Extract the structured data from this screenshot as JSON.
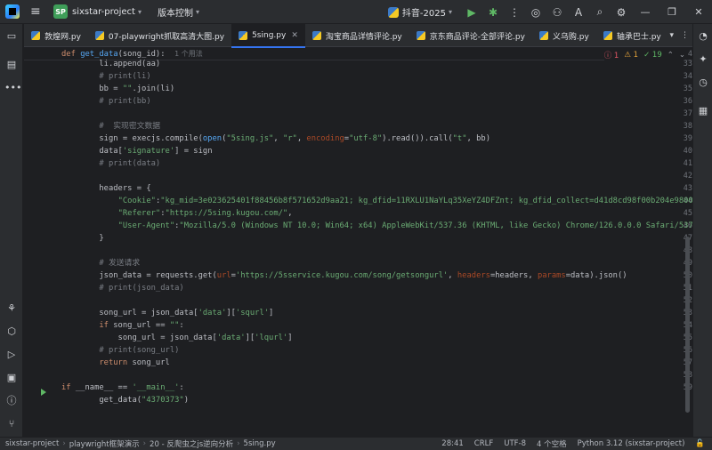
{
  "titlebar": {
    "project_badge": "SP",
    "project_name": "sixstar-project",
    "vcs_label": "版本控制",
    "run_config": "抖音-2025"
  },
  "tabs": [
    {
      "label": "敦煌网.py",
      "active": false
    },
    {
      "label": "07-playwright抓取高清大图.py",
      "active": false
    },
    {
      "label": "5sing.py",
      "active": true
    },
    {
      "label": "淘宝商品详情评论.py",
      "active": false
    },
    {
      "label": "京东商品评论-全部评论.py",
      "active": false
    },
    {
      "label": "义乌购.py",
      "active": false
    },
    {
      "label": "轴承巴士.py",
      "active": false
    }
  ],
  "editor": {
    "sticky_line_number": "4",
    "sticky_usage": "1 个用法",
    "inspections": {
      "errors": "1",
      "warnings": "1",
      "ok": "19"
    },
    "line_numbers": [
      "33",
      "34",
      "35",
      "36",
      "37",
      "38",
      "39",
      "40",
      "41",
      "42",
      "43",
      "44",
      "45",
      "46",
      "47",
      "48",
      "49",
      "50",
      "51",
      "52",
      "53",
      "54",
      "55",
      "56",
      "57",
      "58",
      "59"
    ],
    "run_gutter_line": "58"
  },
  "statusbar": {
    "breadcrumbs": [
      "sixstar-project",
      "playwright框架演示",
      "20 - 反爬虫之js逆向分析",
      "5sing.py"
    ],
    "position": "28:41",
    "line_ending": "CRLF",
    "encoding": "UTF-8",
    "indent": "4 个空格",
    "interpreter": "Python 3.12 (sixstar-project)"
  },
  "colors": {
    "accent": "#3574f0",
    "background": "#1e1f22",
    "panel": "#2b2d30"
  }
}
